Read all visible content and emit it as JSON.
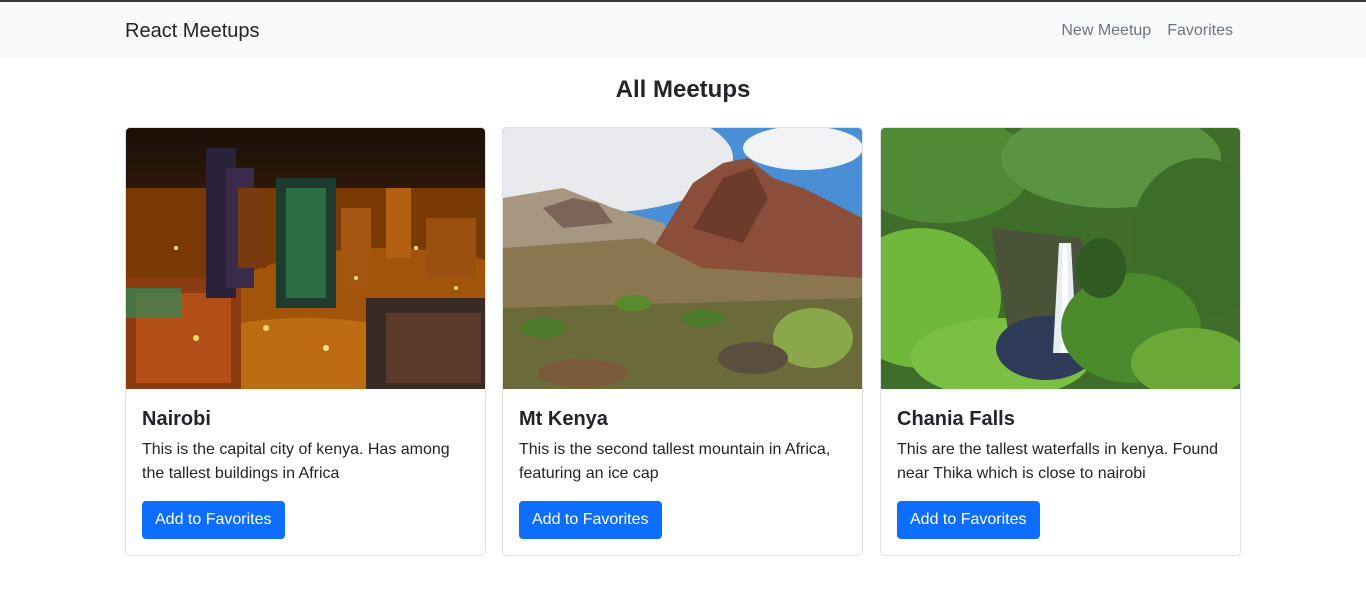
{
  "app": {
    "brand": "React Meetups"
  },
  "nav": {
    "links": [
      {
        "label": "New Meetup"
      },
      {
        "label": "Favorites"
      }
    ]
  },
  "page": {
    "title": "All Meetups"
  },
  "meetups": [
    {
      "title": "Nairobi",
      "description": "This is the capital city of kenya. Has among the tallest buildings in Africa",
      "button_label": "Add to Favorites"
    },
    {
      "title": "Mt Kenya",
      "description": "This is the second tallest mountain in Africa, featuring an ice cap",
      "button_label": "Add to Favorites"
    },
    {
      "title": "Chania Falls",
      "description": "This are the tallest waterfalls in kenya. Found near Thika which is close to nairobi",
      "button_label": "Add to Favorites"
    }
  ],
  "colors": {
    "primary": "#0d6efd",
    "navbar_bg": "#f8f9fa",
    "muted_link": "#6c757d"
  }
}
